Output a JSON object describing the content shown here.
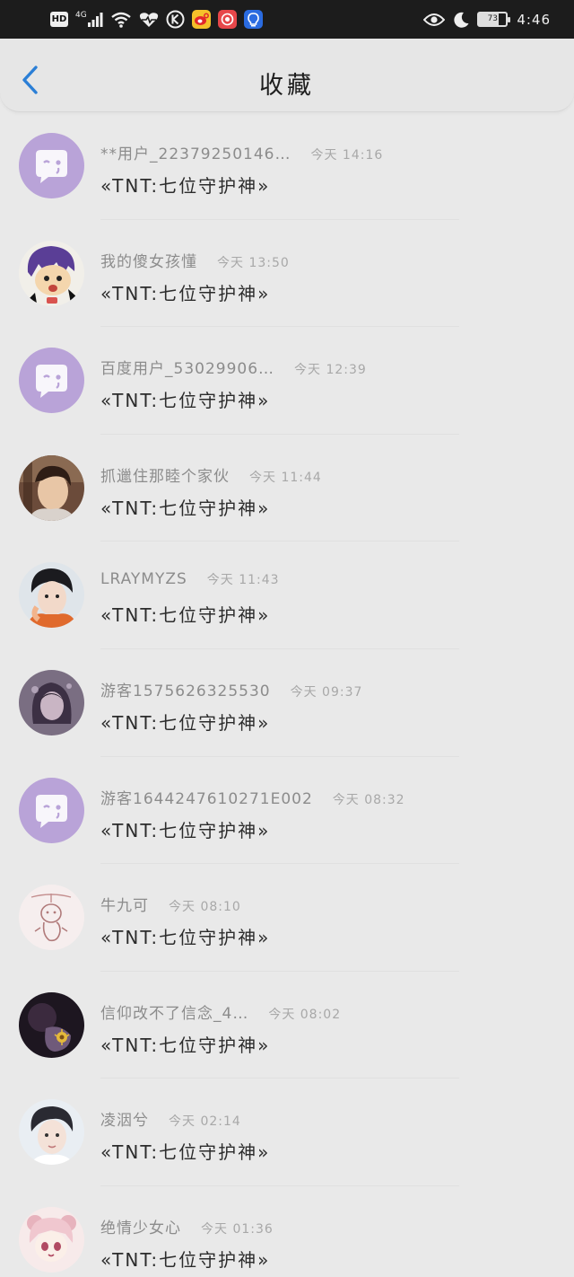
{
  "status_bar": {
    "hd": "HD",
    "network": "4G",
    "battery": "73",
    "time": "4:46",
    "icons_left": [
      "hd-icon",
      "signal-icon",
      "wifi-icon",
      "health-icon",
      "k-app-icon",
      "weibo-icon",
      "podcast-icon",
      "bulb-app-icon"
    ],
    "icons_right": [
      "eye-icon",
      "moon-icon",
      "battery-icon"
    ]
  },
  "header": {
    "title": "收藏",
    "back_icon": "chevron-left-icon",
    "accent": "#2b7fd6"
  },
  "items": [
    {
      "name": "**用户_22379250146…",
      "time": "今天 14:16",
      "message": "«TNT:七位守护神»",
      "avatar": "default"
    },
    {
      "name": "我的傻女孩懂",
      "time": "今天 13:50",
      "message": "«TNT:七位守护神»",
      "avatar": "anime-purple"
    },
    {
      "name": "百度用户_53029906…",
      "time": "今天 12:39",
      "message": "«TNT:七位守护神»",
      "avatar": "default"
    },
    {
      "name": "抓邋住那睦个家伙",
      "time": "今天 11:44",
      "message": "«TNT:七位守护神»",
      "avatar": "photo-warm"
    },
    {
      "name": "LRAYMYZS",
      "time": "今天 11:43",
      "message": "«TNT:七位守护神»",
      "avatar": "photo-cool"
    },
    {
      "name": "游客1575626325530",
      "time": "今天 09:37",
      "message": "«TNT:七位守护神»",
      "avatar": "photo-dark"
    },
    {
      "name": "游客1644247610271E002",
      "time": "今天 08:32",
      "message": "«TNT:七位守护神»",
      "avatar": "default"
    },
    {
      "name": "牛九可",
      "time": "今天 08:10",
      "message": "«TNT:七位守护神»",
      "avatar": "sketch-pink"
    },
    {
      "name": "信仰改不了信念_4…",
      "time": "今天 08:02",
      "message": "«TNT:七位守护神»",
      "avatar": "photo-night"
    },
    {
      "name": "凌洇兮",
      "time": "今天 02:14",
      "message": "«TNT:七位守护神»",
      "avatar": "photo-boy"
    },
    {
      "name": "绝情少女心",
      "time": "今天 01:36",
      "message": "«TNT:七位守护神»",
      "avatar": "anime-pink"
    }
  ]
}
